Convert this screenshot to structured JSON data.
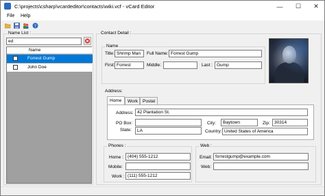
{
  "window": {
    "title": "C:\\projects\\csharp\\vcardeditor\\contacts\\wiki.vcf - vCard Editor",
    "minimize_glyph": "—",
    "maximize_glyph": "☐",
    "close_glyph": "✕"
  },
  "menu": {
    "items": [
      "File",
      "Help"
    ]
  },
  "toolbar": {
    "icons": [
      "open-folder-icon",
      "save-icon",
      "add-contact-icon",
      "help-icon"
    ]
  },
  "name_list": {
    "label": "Name List :",
    "search_value": "ed",
    "column_header": "Name",
    "rows": [
      {
        "name": "Forrest Gump",
        "checked": false,
        "selected": true
      },
      {
        "name": "John Doe",
        "checked": false,
        "selected": false
      }
    ]
  },
  "contact": {
    "group_label": "Contact Detail :",
    "name_group": {
      "label": "Name",
      "title_label": "Title:",
      "title_value": "Shrimp Man",
      "full_name_label": "Full Name:",
      "full_name_value": "Forrest Gump",
      "first_label": "First:",
      "first_value": "Forrest",
      "middle_label": "Middle:",
      "middle_value": "",
      "last_label": "Last :",
      "last_value": "Gump"
    },
    "address": {
      "label": "Address:",
      "tabs": [
        "Home",
        "Work",
        "Postal"
      ],
      "active_tab": "Home",
      "address_label": "Address:",
      "address_value": "42 Plantation St.",
      "po_box_label": "PO Box:",
      "po_box_value": "",
      "city_label": "City:",
      "city_value": "Baytown",
      "zip_label": "Zip:",
      "zip_value": "30314",
      "state_label": "State:",
      "state_value": "LA",
      "country_label": "Country:",
      "country_value": "United States of America"
    },
    "phones": {
      "label": "Phones :",
      "home_label": "Home :",
      "home_value": "(404) 555-1212",
      "mobile_label": "Mobile:",
      "mobile_value": "",
      "work_label": "Work :",
      "work_value": "(111) 555-1212"
    },
    "web": {
      "label": "Web :",
      "email_label": "Email:",
      "email_value": "forrestgump@example.com",
      "web_label": "Web:",
      "web_value": ""
    }
  },
  "colors": {
    "selection": "#0078d7",
    "list_empty_area": "#a0a0a0",
    "window_bg": "#f0f0f0",
    "delete_button": "#d9302b"
  }
}
